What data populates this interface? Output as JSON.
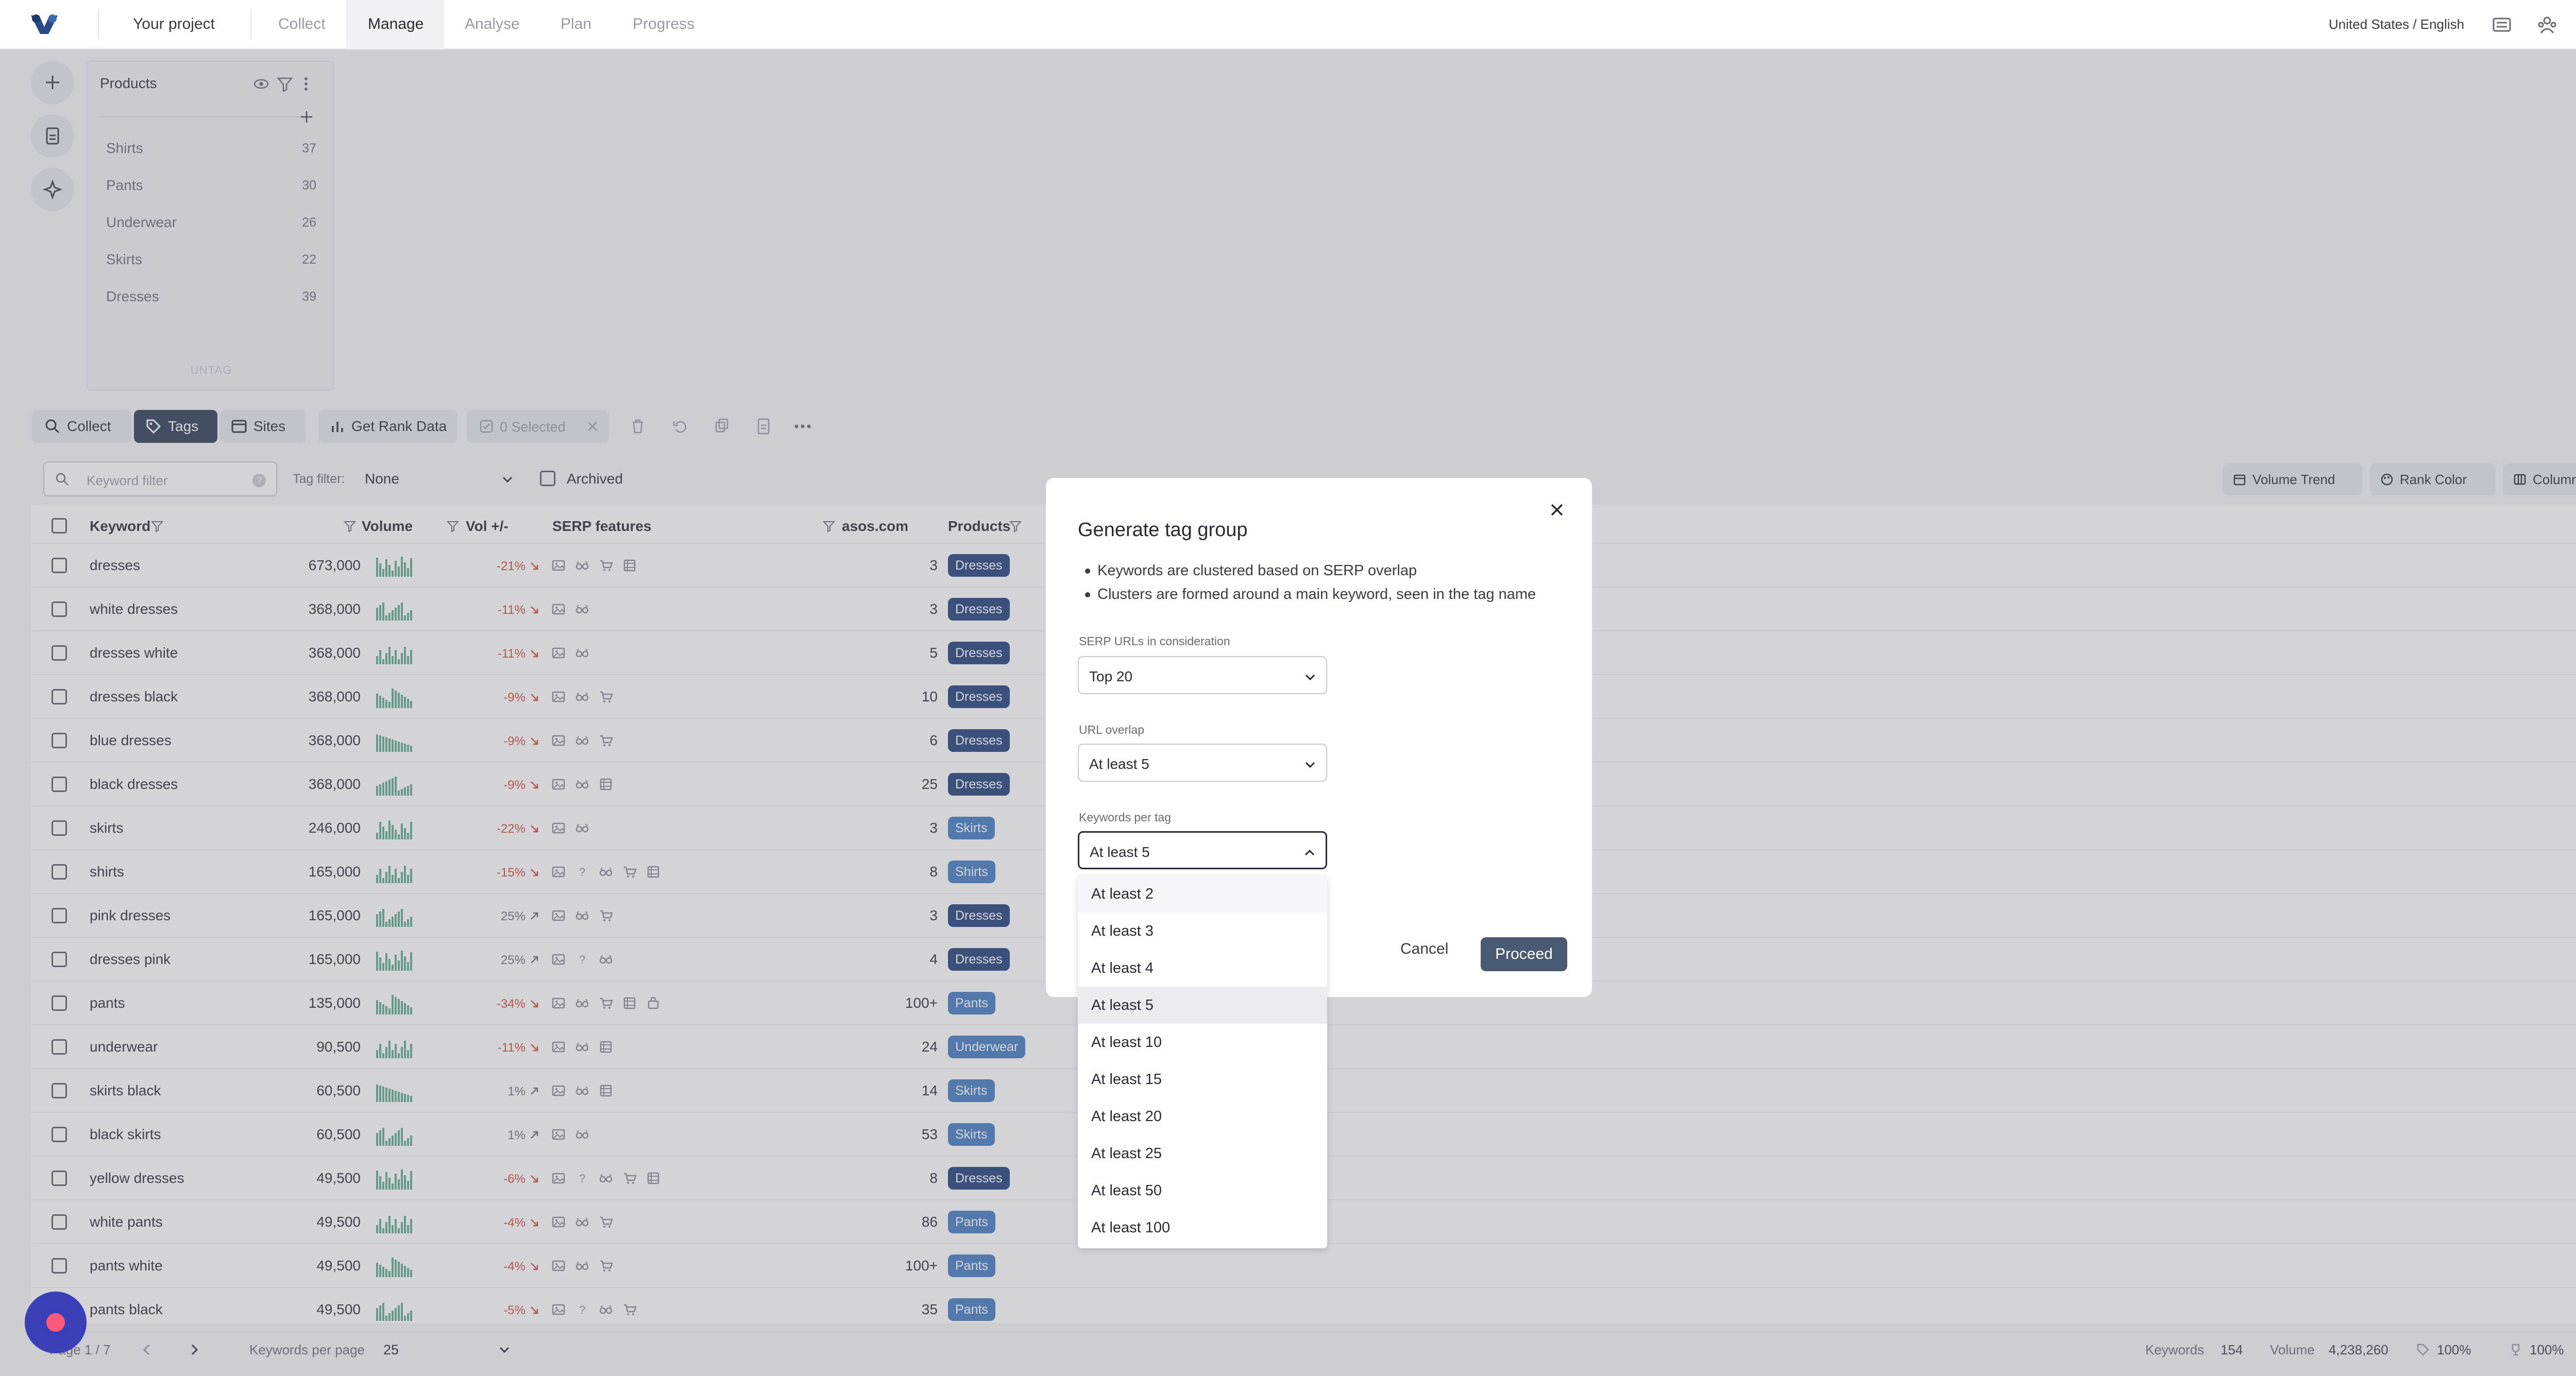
{
  "nav": {
    "project": "Your project",
    "tabs": [
      "Collect",
      "Manage",
      "Analyse",
      "Plan",
      "Progress"
    ],
    "locale": "United States / English"
  },
  "products_panel": {
    "title": "Products",
    "items": [
      {
        "label": "Shirts",
        "count": "37"
      },
      {
        "label": "Pants",
        "count": "30"
      },
      {
        "label": "Underwear",
        "count": "26"
      },
      {
        "label": "Skirts",
        "count": "22"
      },
      {
        "label": "Dresses",
        "count": "39"
      }
    ],
    "untag": "UNTAG"
  },
  "toolbar": {
    "collect": "Collect",
    "tags": "Tags",
    "sites": "Sites",
    "get_rank_data": "Get Rank Data",
    "selected": "0 Selected"
  },
  "filters": {
    "keyword_placeholder": "Keyword filter",
    "tag_filter_label": "Tag filter:",
    "tag_filter_value": "None",
    "archived": "Archived",
    "volume_trend": "Volume Trend",
    "rank_color": "Rank Color",
    "columns": "Columns"
  },
  "table": {
    "headers": {
      "keyword": "Keyword",
      "volume": "Volume",
      "vol_change": "Vol +/-",
      "serp": "SERP features",
      "site": "asos.com",
      "products": "Products"
    },
    "rows": [
      {
        "keyword": "dresses",
        "volume": "673,000",
        "change": "-21%",
        "dir": "down",
        "rank": "3",
        "tag": "Dresses",
        "tagstyle": "dark"
      },
      {
        "keyword": "white dresses",
        "volume": "368,000",
        "change": "-11%",
        "dir": "down",
        "rank": "3",
        "tag": "Dresses",
        "tagstyle": "dark"
      },
      {
        "keyword": "dresses white",
        "volume": "368,000",
        "change": "-11%",
        "dir": "down",
        "rank": "5",
        "tag": "Dresses",
        "tagstyle": "dark"
      },
      {
        "keyword": "dresses black",
        "volume": "368,000",
        "change": "-9%",
        "dir": "down",
        "rank": "10",
        "tag": "Dresses",
        "tagstyle": "dark"
      },
      {
        "keyword": "blue dresses",
        "volume": "368,000",
        "change": "-9%",
        "dir": "down",
        "rank": "6",
        "tag": "Dresses",
        "tagstyle": "dark"
      },
      {
        "keyword": "black dresses",
        "volume": "368,000",
        "change": "-9%",
        "dir": "down",
        "rank": "25",
        "tag": "Dresses",
        "tagstyle": "dark"
      },
      {
        "keyword": "skirts",
        "volume": "246,000",
        "change": "-22%",
        "dir": "down",
        "rank": "3",
        "tag": "Skirts",
        "tagstyle": "light"
      },
      {
        "keyword": "shirts",
        "volume": "165,000",
        "change": "-15%",
        "dir": "down",
        "rank": "8",
        "tag": "Shirts",
        "tagstyle": "light"
      },
      {
        "keyword": "pink dresses",
        "volume": "165,000",
        "change": "25%",
        "dir": "up",
        "rank": "3",
        "tag": "Dresses",
        "tagstyle": "dark"
      },
      {
        "keyword": "dresses pink",
        "volume": "165,000",
        "change": "25%",
        "dir": "up",
        "rank": "4",
        "tag": "Dresses",
        "tagstyle": "dark"
      },
      {
        "keyword": "pants",
        "volume": "135,000",
        "change": "-34%",
        "dir": "down",
        "rank": "100+",
        "tag": "Pants",
        "tagstyle": "light"
      },
      {
        "keyword": "underwear",
        "volume": "90,500",
        "change": "-11%",
        "dir": "down",
        "rank": "24",
        "tag": "Underwear",
        "tagstyle": "light"
      },
      {
        "keyword": "skirts black",
        "volume": "60,500",
        "change": "1%",
        "dir": "up",
        "rank": "14",
        "tag": "Skirts",
        "tagstyle": "light"
      },
      {
        "keyword": "black skirts",
        "volume": "60,500",
        "change": "1%",
        "dir": "up",
        "rank": "53",
        "tag": "Skirts",
        "tagstyle": "light"
      },
      {
        "keyword": "yellow dresses",
        "volume": "49,500",
        "change": "-6%",
        "dir": "down",
        "rank": "8",
        "tag": "Dresses",
        "tagstyle": "dark"
      },
      {
        "keyword": "white pants",
        "volume": "49,500",
        "change": "-4%",
        "dir": "down",
        "rank": "86",
        "tag": "Pants",
        "tagstyle": "light"
      },
      {
        "keyword": "pants white",
        "volume": "49,500",
        "change": "-4%",
        "dir": "down",
        "rank": "100+",
        "tag": "Pants",
        "tagstyle": "light"
      },
      {
        "keyword": "pants black",
        "volume": "49,500",
        "change": "-5%",
        "dir": "down",
        "rank": "35",
        "tag": "Pants",
        "tagstyle": "light"
      }
    ]
  },
  "modal": {
    "title": "Generate tag group",
    "bullets": [
      "Keywords are clustered based on SERP overlap",
      "Clusters are formed around a main keyword, seen in the tag name"
    ],
    "serp_label": "SERP URLs in consideration",
    "serp_value": "Top 20",
    "overlap_label": "URL overlap",
    "overlap_value": "At least 5",
    "kpt_label": "Keywords per tag",
    "kpt_value": "At least 5",
    "cancel": "Cancel",
    "proceed": "Proceed",
    "options": [
      "At least 2",
      "At least 3",
      "At least 4",
      "At least 5",
      "At least 10",
      "At least 15",
      "At least 20",
      "At least 25",
      "At least 50",
      "At least 100"
    ],
    "selected_option": "At least 5"
  },
  "footer": {
    "page": "Page 1 / 7",
    "per_page_label": "Keywords per page",
    "per_page_value": "25",
    "keywords_label": "Keywords",
    "keywords_value": "154",
    "volume_label": "Volume",
    "volume_value": "4,238,260",
    "pct1": "100%",
    "pct2": "100%"
  }
}
